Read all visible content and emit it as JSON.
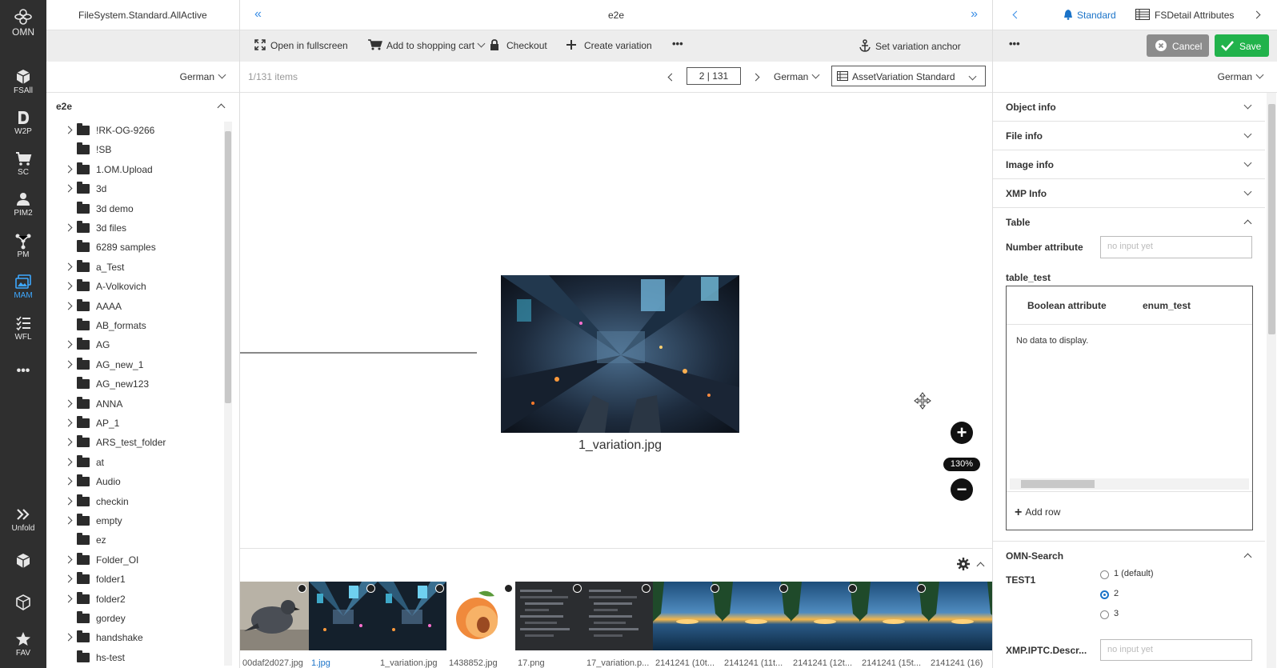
{
  "rail": {
    "logo_label": "OMN",
    "items": [
      {
        "label": "FSAll",
        "icon": "cube-icon"
      },
      {
        "label": "W2P",
        "icon": "d-letter-icon"
      },
      {
        "label": "SC",
        "icon": "cart-icon"
      },
      {
        "label": "PIM2",
        "icon": "person-icon"
      },
      {
        "label": "PM",
        "icon": "network-icon"
      },
      {
        "label": "MAM",
        "icon": "images-icon",
        "active": true
      },
      {
        "label": "WFL",
        "icon": "list-icon"
      }
    ],
    "more_label": "•••",
    "unfold_label": "Unfold",
    "fav_label": "FAV",
    "accent": "#3ea8ff"
  },
  "tree_panel": {
    "title": "FileSystem.Standard.AllActive",
    "language": "German",
    "root": "e2e",
    "folders": [
      {
        "name": "!RK-OG-9266",
        "expandable": true
      },
      {
        "name": "!SB",
        "expandable": false
      },
      {
        "name": "1.OM.Upload",
        "expandable": true
      },
      {
        "name": "3d",
        "expandable": true
      },
      {
        "name": "3d demo",
        "expandable": false
      },
      {
        "name": "3d files",
        "expandable": true
      },
      {
        "name": "6289 samples",
        "expandable": false
      },
      {
        "name": "a_Test",
        "expandable": true
      },
      {
        "name": "A-Volkovich",
        "expandable": true
      },
      {
        "name": "AAAA",
        "expandable": true
      },
      {
        "name": "AB_formats",
        "expandable": false
      },
      {
        "name": "AG",
        "expandable": true
      },
      {
        "name": "AG_new_1",
        "expandable": true
      },
      {
        "name": "AG_new123",
        "expandable": false
      },
      {
        "name": "ANNA",
        "expandable": true
      },
      {
        "name": "AP_1",
        "expandable": true
      },
      {
        "name": "ARS_test_folder",
        "expandable": true
      },
      {
        "name": "at",
        "expandable": true
      },
      {
        "name": "Audio",
        "expandable": true
      },
      {
        "name": "checkin",
        "expandable": true
      },
      {
        "name": "empty",
        "expandable": true
      },
      {
        "name": "ez",
        "expandable": false
      },
      {
        "name": "Folder_OI",
        "expandable": true
      },
      {
        "name": "folder1",
        "expandable": true
      },
      {
        "name": "folder2",
        "expandable": true
      },
      {
        "name": "gordey",
        "expandable": false
      },
      {
        "name": "handshake",
        "expandable": true
      },
      {
        "name": "hs-test",
        "expandable": false
      }
    ]
  },
  "main": {
    "title": "e2e",
    "collapse_left": "«",
    "collapse_right": "»",
    "toolbar": {
      "fullscreen": "Open in fullscreen",
      "cart": "Add to shopping cart",
      "checkout": "Checkout",
      "create_variation": "Create variation",
      "more": "•••",
      "anchor": "Set variation anchor"
    },
    "items_count": "1/131 items",
    "pager": "2 | 131",
    "language": "German",
    "view_mode": "AssetVariation Standard",
    "image_caption": "1_variation.jpg",
    "zoom": "130%",
    "thumbnails": [
      {
        "label": "00daf2d027.jpg",
        "kind": "pigeon",
        "badge": true
      },
      {
        "label": "1.jpg",
        "kind": "city",
        "badge": true,
        "selected": true
      },
      {
        "label": "1_variation.jpg",
        "kind": "city",
        "badge": true
      },
      {
        "label": "1438852.jpg",
        "kind": "peach",
        "badge": true
      },
      {
        "label": "17.png",
        "kind": "code",
        "badge": true
      },
      {
        "label": "17_variation.p...",
        "kind": "code",
        "badge": true
      },
      {
        "label": "2141241 (10t...",
        "kind": "sunset",
        "badge": true
      },
      {
        "label": "2141241 (11t...",
        "kind": "sunset",
        "badge": true
      },
      {
        "label": "2141241 (12t...",
        "kind": "sunset",
        "badge": true
      },
      {
        "label": "2141241 (15t...",
        "kind": "sunset",
        "badge": true
      },
      {
        "label": "2141241 (16)",
        "kind": "sunset",
        "badge": false
      }
    ]
  },
  "right_panel": {
    "tabs": {
      "standard": "Standard",
      "detail": "FSDetail Attributes"
    },
    "more": "•••",
    "cancel": "Cancel",
    "save": "Save",
    "language": "German",
    "sections": [
      "Object info",
      "File info",
      "Image info",
      "XMP Info",
      "Table"
    ],
    "number_attr_label": "Number attribute",
    "number_attr_placeholder": "no input yet",
    "table_label": "table_test",
    "table_columns": [
      "Boolean attribute",
      "enum_test"
    ],
    "table_empty": "No data to display.",
    "add_row": "Add row",
    "omn_search": "OMN-Search",
    "test1_label": "TEST1",
    "radio_options": [
      "1 (default)",
      "2",
      "3"
    ],
    "radio_selected": "2",
    "iptc_label": "XMP.IPTC.Descr...",
    "iptc_placeholder": "no input yet",
    "save_color": "#21b24b",
    "cancel_color": "#8c8c8c",
    "tab_color": "#1a73c8"
  }
}
